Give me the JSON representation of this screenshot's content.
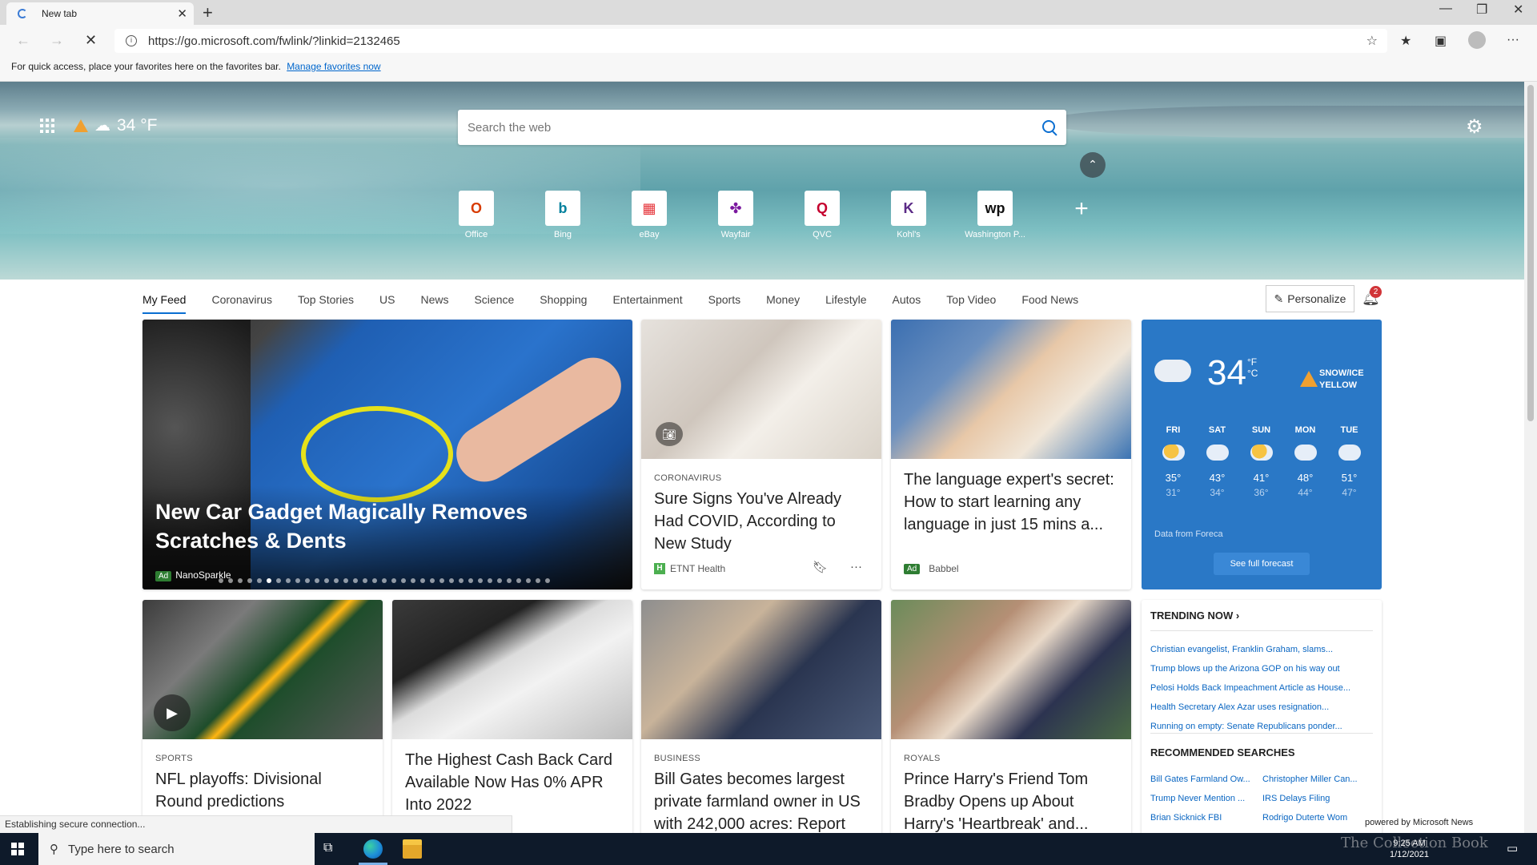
{
  "browser": {
    "tab_title": "New tab",
    "url": "https://go.microsoft.com/fwlink/?linkid=2132465",
    "favorites_hint": "For quick access, place your favorites here on the favorites bar.",
    "favorites_link": "Manage favorites now",
    "status": "Establishing secure connection..."
  },
  "hero": {
    "weather_temp": "34 °F",
    "search_placeholder": "Search the web",
    "tiles": [
      {
        "label": "Office",
        "icon": "office-icon",
        "color": "#d83b01"
      },
      {
        "label": "Bing",
        "icon": "bing-icon",
        "color": "#00809d"
      },
      {
        "label": "eBay",
        "icon": "ebay-icon",
        "color": "#e53238"
      },
      {
        "label": "Wayfair",
        "icon": "wayfair-icon",
        "color": "#7b189f"
      },
      {
        "label": "QVC",
        "icon": "qvc-icon",
        "color": "#c5002e"
      },
      {
        "label": "Kohl's",
        "icon": "kohls-icon",
        "color": "#5b2a86"
      },
      {
        "label": "Washington P...",
        "icon": "washington-post-icon",
        "color": "#111111"
      }
    ]
  },
  "nav": {
    "items": [
      "My Feed",
      "Coronavirus",
      "Top Stories",
      "US",
      "News",
      "Science",
      "Shopping",
      "Entertainment",
      "Sports",
      "Money",
      "Lifestyle",
      "Autos",
      "Top Video",
      "Food News"
    ],
    "personalize": "Personalize",
    "notifications": "2"
  },
  "cards": {
    "hero": {
      "title": "New Car Gadget Magically Removes Scratches & Dents",
      "ad": "Ad",
      "source": "NanoSparkle"
    },
    "covid": {
      "category": "CORONAVIRUS",
      "title": "Sure Signs You've Already Had COVID, According to New Study",
      "source": "ETNT Health",
      "logo": "H"
    },
    "language": {
      "title": "The language expert's secret: How to start learning any language in just 15 mins a...",
      "ad": "Ad",
      "source": "Babbel"
    },
    "nfl": {
      "category": "SPORTS",
      "title": "NFL playoffs: Divisional Round predictions"
    },
    "card": {
      "title": "The Highest Cash Back Card Available Now Has 0% APR Into 2022"
    },
    "gates": {
      "category": "BUSINESS",
      "title": "Bill Gates becomes largest private farmland owner in US with 242,000 acres: Report"
    },
    "harry": {
      "category": "ROYALS",
      "title": "Prince Harry's Friend Tom Bradby Opens up About Harry's 'Heartbreak' and..."
    }
  },
  "weather": {
    "temp": "34",
    "unit_f": "°F",
    "unit_c": "°C",
    "alert_line1": "SNOW/ICE",
    "alert_line2": "YELLOW",
    "days": [
      {
        "name": "FRI",
        "hi": "35°",
        "lo": "31°",
        "icon": "partly-sunny-icon"
      },
      {
        "name": "SAT",
        "hi": "43°",
        "lo": "34°",
        "icon": "snow-icon"
      },
      {
        "name": "SUN",
        "hi": "41°",
        "lo": "36°",
        "icon": "sunny-cloud-icon"
      },
      {
        "name": "MON",
        "hi": "48°",
        "lo": "44°",
        "icon": "snow-icon"
      },
      {
        "name": "TUE",
        "hi": "51°",
        "lo": "47°",
        "icon": "snow-icon"
      }
    ],
    "source": "Data from Foreca",
    "forecast_button": "See full forecast"
  },
  "trending": {
    "heading": "TRENDING NOW",
    "items": [
      "Christian evangelist, Franklin Graham, slams...",
      "Trump blows up the Arizona GOP on his way out",
      "Pelosi Holds Back Impeachment Article as House...",
      "Health Secretary Alex Azar uses resignation...",
      "Running on empty: Senate Republicans ponder..."
    ],
    "rec_heading": "RECOMMENDED SEARCHES",
    "rec": [
      "Bill Gates Farmland Ow...",
      "Christopher Miller Can...",
      "Trump Never Mention ...",
      "IRS Delays Filing",
      "Brian Sicknick FBI",
      "Rodrigo Duterte Wom"
    ],
    "powered_by": "powered by Microsoft News"
  },
  "taskbar": {
    "search_placeholder": "Type here to search",
    "time": "9:25 AM",
    "date": "1/12/2021"
  },
  "watermark": "The Collection Book"
}
